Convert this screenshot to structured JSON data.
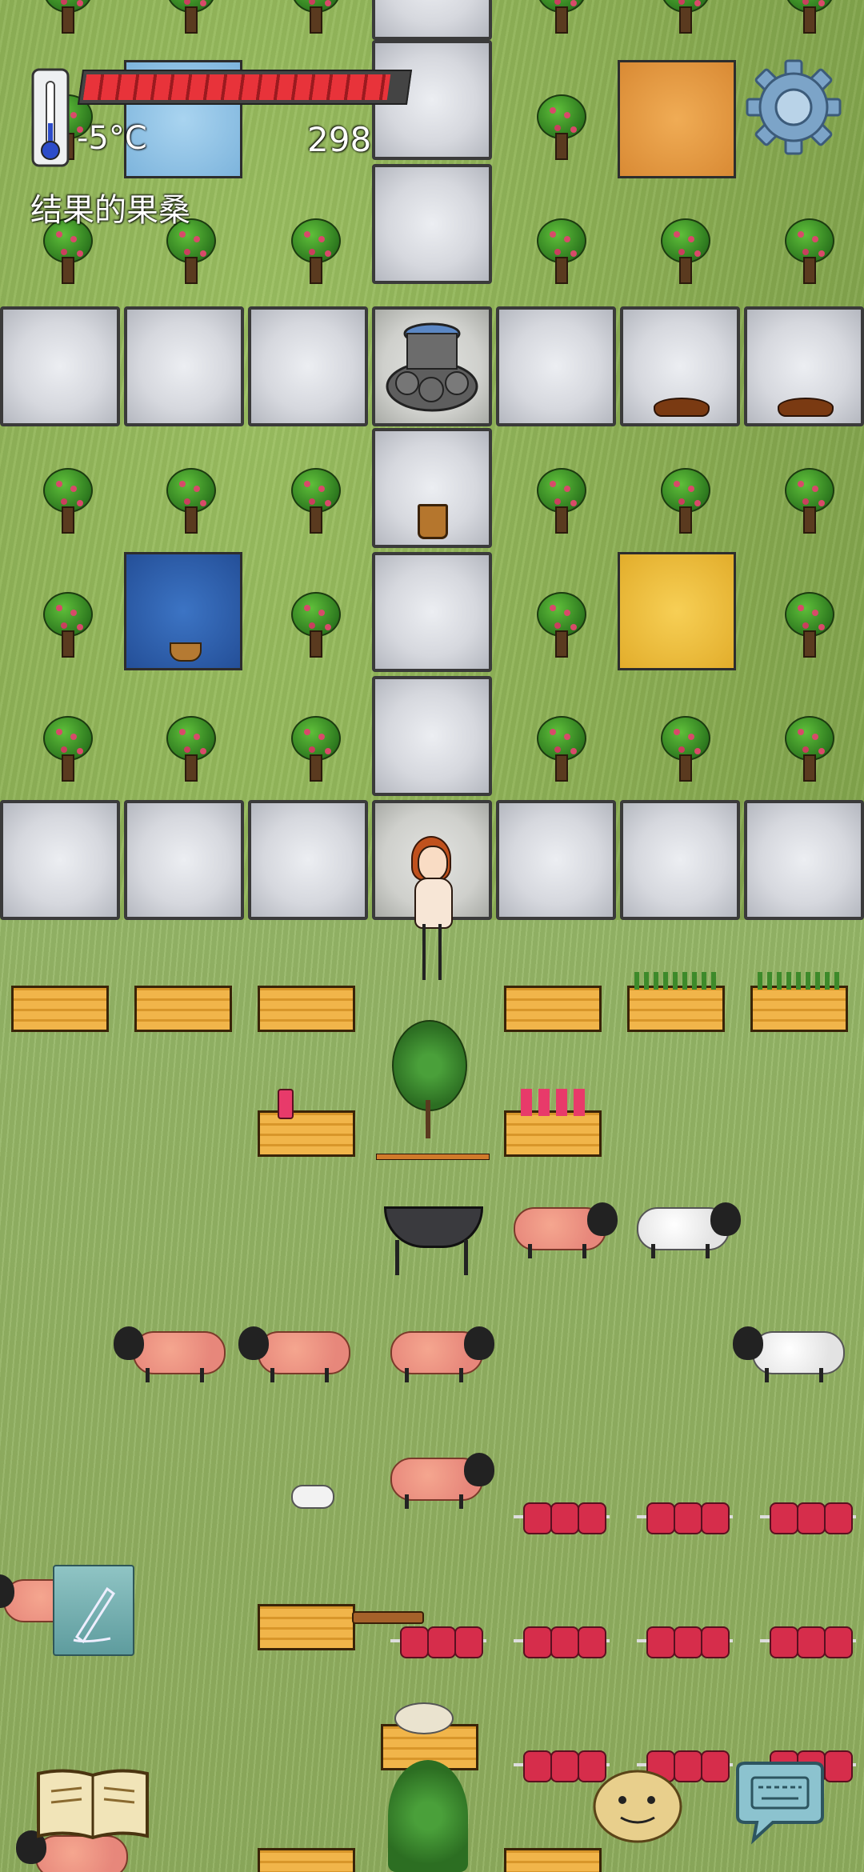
{
  "hud": {
    "temperature": "-5°C",
    "food_count": "298",
    "status_label": "结果的果桑",
    "food_bar_segments": 17,
    "food_bar_fraction": 0.95
  },
  "icons": {
    "settings": "gear-icon",
    "thermometer": "thermometer-icon",
    "note": "pencil-icon",
    "book": "book-icon",
    "emote": "face-icon",
    "keyboard": "keyboard-icon"
  },
  "colors": {
    "food_bar": "#e8333a",
    "carpet_blue_light": "#8fc3e8",
    "carpet_blue": "#2f64b6",
    "carpet_orange": "#e59a42",
    "carpet_yellow": "#f0c03f",
    "stone": "#d6d8de"
  }
}
